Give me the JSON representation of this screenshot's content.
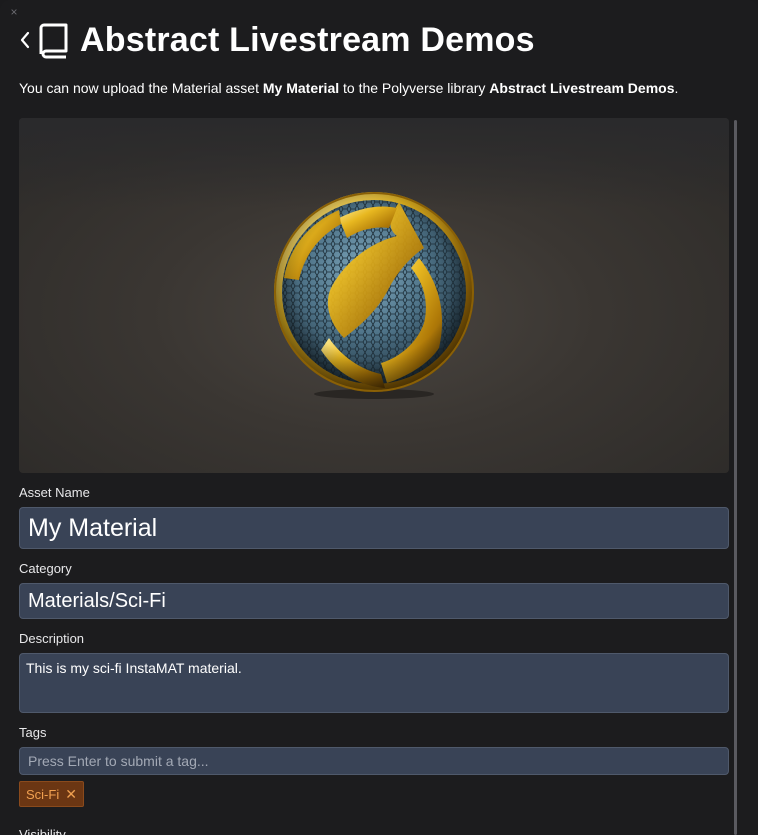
{
  "window": {
    "close_glyph": "×",
    "title": "Abstract Livestream Demos"
  },
  "header": {
    "back_icon": "chevron-left-icon",
    "book_icon": "book-icon"
  },
  "intro": {
    "prefix": "You can now upload the Material asset ",
    "asset_name": "My Material",
    "middle": " to the Polyverse library ",
    "library_name": "Abstract Livestream Demos",
    "suffix": "."
  },
  "form": {
    "asset_name_label": "Asset Name",
    "asset_name_value": "My Material",
    "category_label": "Category",
    "category_value": "Materials/Sci-Fi",
    "description_label": "Description",
    "description_value": "This is my sci-fi InstaMAT material.",
    "tags_label": "Tags",
    "tags_placeholder": "Press Enter to submit a tag...",
    "tags": [
      {
        "label": "Sci-Fi",
        "remove_glyph": "✕"
      }
    ],
    "visibility_label": "Visibility"
  },
  "colors": {
    "background": "#1c1c1e",
    "input_bg": "#394356",
    "tag_bg": "#6b3613",
    "tag_text": "#f0a050"
  }
}
